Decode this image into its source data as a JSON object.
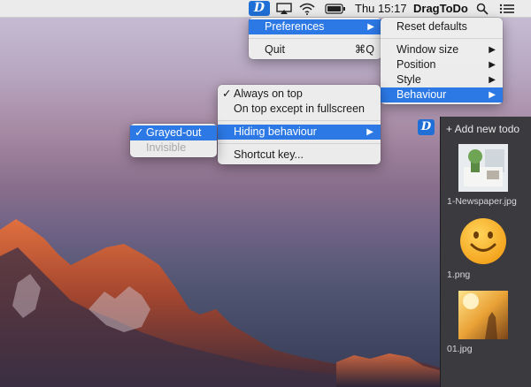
{
  "menubar": {
    "clock": "Thu 15:17",
    "app_name": "DragToDo"
  },
  "app_menu": {
    "items": [
      {
        "label": "Preferences",
        "arrow": "▶"
      },
      {
        "label": "Quit",
        "shortcut": "⌘Q"
      }
    ]
  },
  "prefs_menu": {
    "items": [
      {
        "label": "Reset defaults"
      },
      {
        "label": "Window size",
        "arrow": "▶"
      },
      {
        "label": "Position",
        "arrow": "▶"
      },
      {
        "label": "Style",
        "arrow": "▶"
      },
      {
        "label": "Behaviour",
        "arrow": "▶"
      }
    ]
  },
  "behaviour_menu": {
    "items": [
      {
        "label": "Always on top",
        "check": "✓"
      },
      {
        "label": "On top except in fullscreen"
      },
      {
        "label": "Hiding behaviour",
        "arrow": "▶"
      },
      {
        "label": "Shortcut key..."
      }
    ]
  },
  "hiding_menu": {
    "items": [
      {
        "label": "Grayed-out",
        "check": "✓"
      },
      {
        "label": "Invisible"
      }
    ]
  },
  "panel": {
    "icon_letter": "D",
    "add_label": "+ Add new todo",
    "files": [
      {
        "name": "1-Newspaper.jpg"
      },
      {
        "name": "1.png"
      },
      {
        "name": "01.jpg"
      }
    ]
  },
  "icons": {
    "app": "dragtodo-app-icon",
    "airplay": "airplay-icon",
    "wifi": "wifi-icon",
    "battery": "battery-icon",
    "search": "spotlight-search-icon",
    "notifications": "notification-center-icon"
  }
}
